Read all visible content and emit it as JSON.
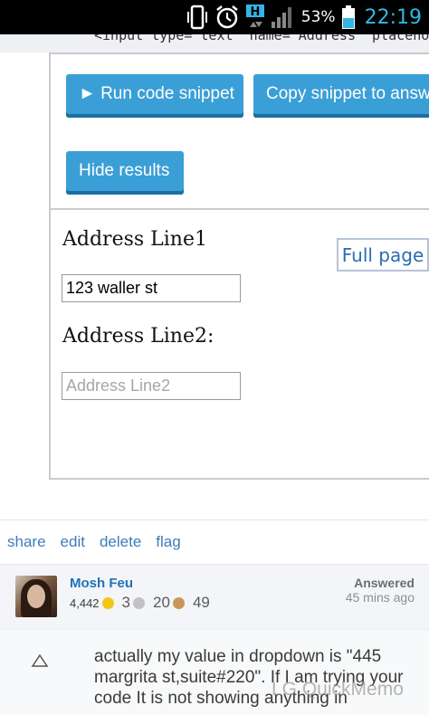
{
  "status_bar": {
    "battery_percent": "53%",
    "time": "22:19",
    "network_type": "H",
    "icons": [
      "vibrate-icon",
      "alarm-clock-icon",
      "data-arrows-icon",
      "signal-bars-icon",
      "battery-icon"
    ]
  },
  "code_line": "<input type=\"text\" name=\"Address\" placeholder=",
  "snippet": {
    "run_label": "► Run code snippet",
    "copy_label": "Copy snippet to answer",
    "hide_label": "Hide results",
    "fullpage_label": "Full page"
  },
  "result": {
    "label1": "Address Line1",
    "input1_value": "123 waller st",
    "label2": "Address Line2:",
    "input2_placeholder": "Address Line2"
  },
  "post_menu": {
    "share": "share",
    "edit": "edit",
    "delete": "delete",
    "flag": "flag"
  },
  "user": {
    "name": "Mosh Feu",
    "reputation": "4,442",
    "gold": "3",
    "silver": "20",
    "bronze": "49",
    "answered_label": "Answered",
    "answered_time": "45 mins ago"
  },
  "comment": {
    "text": "actually my value in dropdown is \"445 margrita st,suite#220\". If I am trying your code It is not showing anything in",
    "watermark": "LG QuickMemo"
  },
  "colors": {
    "accent_blue": "#3a9fd6",
    "link_blue": "#3c7cbb",
    "clock_blue": "#35b5e5",
    "gold": "#f5c518",
    "silver": "#b8b8b8",
    "bronze": "#c9975a"
  }
}
